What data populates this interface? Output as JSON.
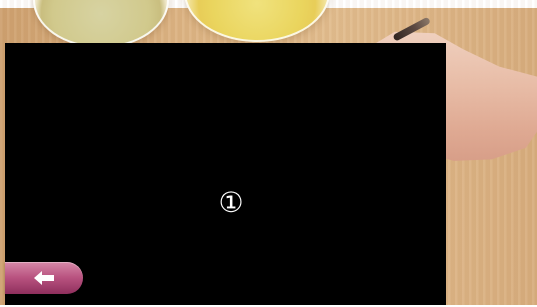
{
  "screen": {
    "step_label": "①",
    "back_icon": "arrow-left-icon",
    "colors": {
      "overlay": "#000000",
      "button_pink": "#b95380",
      "button_pink_dark": "#8f2f5d",
      "icon_white": "#ffffff"
    }
  }
}
